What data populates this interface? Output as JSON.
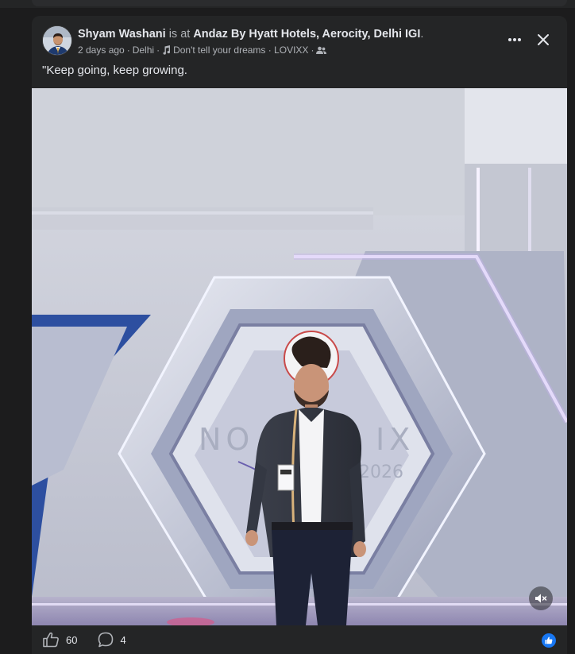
{
  "post": {
    "author": "Shyam Washani",
    "is_at": "is at",
    "location": "Andaz By Hyatt Hotels, Aerocity, Delhi IGI",
    "period": ".",
    "time": "2 days ago",
    "sep1": "·",
    "city": "Delhi",
    "sep2": "·",
    "song": "Don't tell your dreams · LOVIXX",
    "sep3": "·",
    "caption": "\"Keep going, keep growing."
  },
  "photo": {
    "backdrop_text": "NOVATRIX 2026"
  },
  "footer": {
    "likes": "60",
    "comments": "4"
  },
  "icons": {
    "more": "more-options-icon",
    "close": "close-icon",
    "music": "music-note-icon",
    "audience": "friends-audience-icon",
    "mute": "speaker-muted-icon",
    "like": "thumbs-up-icon",
    "comment": "comment-bubble-icon"
  },
  "colors": {
    "card_bg": "#242526",
    "page_bg": "#1c1c1d",
    "text_primary": "#e4e6eb",
    "text_secondary": "#b0b3b8",
    "like_blue": "#1877f2"
  }
}
